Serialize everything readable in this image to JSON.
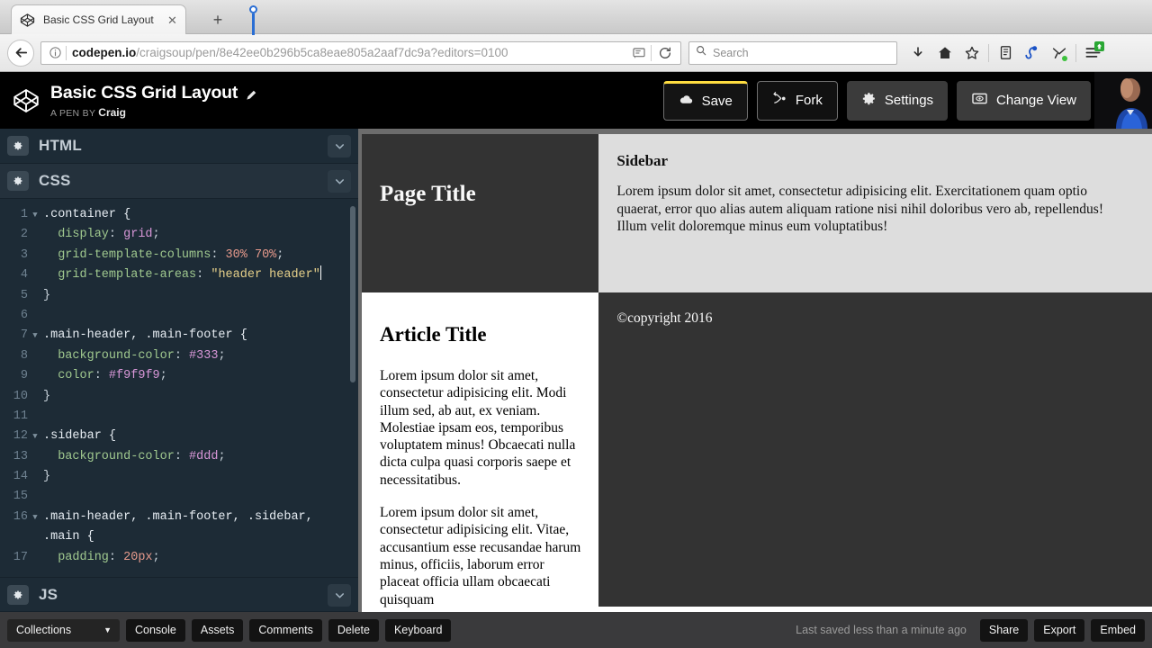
{
  "browser": {
    "tab": {
      "title": "Basic CSS Grid Layout",
      "favicon_icon": "codepen-favicon-icon",
      "close_icon": "close-icon"
    },
    "new_tab_label": "+",
    "back_icon": "back-arrow-icon",
    "url": {
      "domain": "codepen.io",
      "path": "/craigsoup/pen/8e42ee0b296b5ca8eae805a2aaf7dc9a?editors=0100"
    },
    "url_info_icon": "info-circle-icon",
    "reader_icon": "reader-view-icon",
    "reload_icon": "reload-icon",
    "search": {
      "placeholder": "Search",
      "icon": "search-icon"
    },
    "toolbar_icons": [
      "downloads-icon",
      "home-icon",
      "bookmark-star-icon",
      "library-icon",
      "sync-icon",
      "pocket-icon",
      "hamburger-menu-icon"
    ]
  },
  "codepen": {
    "logo_icon": "codepen-logo-icon",
    "pen_title": "Basic CSS Grid Layout",
    "edit_title_icon": "pencil-icon",
    "byline_prefix": "A PEN BY",
    "author": "Craig",
    "actions": [
      {
        "label": "Save",
        "icon": "cloud-icon",
        "style": "save"
      },
      {
        "label": "Fork",
        "icon": "fork-icon",
        "style": "outline"
      },
      {
        "label": "Settings",
        "icon": "gear-icon",
        "style": "solid"
      },
      {
        "label": "Change View",
        "icon": "screen-icon",
        "style": "solid"
      }
    ],
    "avatar_alt": "Craig",
    "editors": [
      {
        "name": "HTML",
        "collapsed": true,
        "gear_icon": "gear-icon",
        "chevron_icon": "chevron-down-icon"
      },
      {
        "name": "CSS",
        "collapsed": false,
        "gear_icon": "gear-icon",
        "chevron_icon": "chevron-down-icon"
      },
      {
        "name": "JS",
        "collapsed": true,
        "gear_icon": "gear-icon",
        "chevron_icon": "chevron-down-icon"
      }
    ],
    "css_code": [
      {
        "n": "1",
        "fold": true,
        "parts": [
          [
            "sel",
            ".container {"
          ]
        ]
      },
      {
        "n": "2",
        "fold": false,
        "parts": [
          [
            "plain",
            "  "
          ],
          [
            "prop",
            "display"
          ],
          [
            "punc",
            ": "
          ],
          [
            "val",
            "grid"
          ],
          [
            "punc",
            ";"
          ]
        ]
      },
      {
        "n": "3",
        "fold": false,
        "parts": [
          [
            "plain",
            "  "
          ],
          [
            "prop",
            "grid-template-columns"
          ],
          [
            "punc",
            ": "
          ],
          [
            "num",
            "30%"
          ],
          [
            "plain",
            " "
          ],
          [
            "num",
            "70%"
          ],
          [
            "punc",
            ";"
          ]
        ]
      },
      {
        "n": "4",
        "fold": false,
        "parts": [
          [
            "plain",
            "  "
          ],
          [
            "prop",
            "grid-template-areas"
          ],
          [
            "punc",
            ": "
          ],
          [
            "str",
            "\"header header\""
          ],
          [
            "caret",
            ""
          ]
        ]
      },
      {
        "n": "5",
        "fold": false,
        "parts": [
          [
            "punc",
            "}"
          ]
        ]
      },
      {
        "n": "6",
        "fold": false,
        "parts": []
      },
      {
        "n": "7",
        "fold": true,
        "parts": [
          [
            "sel",
            ".main-header, .main-footer {"
          ]
        ]
      },
      {
        "n": "8",
        "fold": false,
        "parts": [
          [
            "plain",
            "  "
          ],
          [
            "prop",
            "background-color"
          ],
          [
            "punc",
            ": "
          ],
          [
            "val",
            "#333"
          ],
          [
            "punc",
            ";"
          ]
        ]
      },
      {
        "n": "9",
        "fold": false,
        "parts": [
          [
            "plain",
            "  "
          ],
          [
            "prop",
            "color"
          ],
          [
            "punc",
            ": "
          ],
          [
            "val",
            "#f9f9f9"
          ],
          [
            "punc",
            ";"
          ]
        ]
      },
      {
        "n": "10",
        "fold": false,
        "parts": [
          [
            "punc",
            "}"
          ]
        ]
      },
      {
        "n": "11",
        "fold": false,
        "parts": []
      },
      {
        "n": "12",
        "fold": true,
        "parts": [
          [
            "sel",
            ".sidebar {"
          ]
        ]
      },
      {
        "n": "13",
        "fold": false,
        "parts": [
          [
            "plain",
            "  "
          ],
          [
            "prop",
            "background-color"
          ],
          [
            "punc",
            ": "
          ],
          [
            "val",
            "#ddd"
          ],
          [
            "punc",
            ";"
          ]
        ]
      },
      {
        "n": "14",
        "fold": false,
        "parts": [
          [
            "punc",
            "}"
          ]
        ]
      },
      {
        "n": "15",
        "fold": false,
        "parts": []
      },
      {
        "n": "16",
        "fold": true,
        "parts": [
          [
            "sel",
            ".main-header, .main-footer, .sidebar,"
          ]
        ]
      },
      {
        "n": "",
        "fold": false,
        "parts": [
          [
            "sel",
            ".main {"
          ]
        ]
      },
      {
        "n": "17",
        "fold": false,
        "parts": [
          [
            "plain",
            "  "
          ],
          [
            "prop",
            "padding"
          ],
          [
            "punc",
            ": "
          ],
          [
            "num",
            "20px"
          ],
          [
            "punc",
            ";"
          ]
        ]
      }
    ],
    "footer": {
      "collections_label": "Collections",
      "collections_caret_icon": "chevron-down-icon",
      "buttons": [
        "Console",
        "Assets",
        "Comments",
        "Delete",
        "Keyboard"
      ],
      "status": "Last saved less than a minute ago",
      "right_buttons": [
        "Share",
        "Export",
        "Embed"
      ]
    }
  },
  "preview": {
    "header_title": "Page Title",
    "sidebar_title": "Sidebar",
    "sidebar_text": "Lorem ipsum dolor sit amet, consectetur adipisicing elit. Exercitationem quam optio quaerat, error quo alias autem aliquam ratione nisi nihil doloribus vero ab, repellendus! Illum velit doloremque minus eum voluptatibus!",
    "article_title": "Article Title",
    "article_p1": "Lorem ipsum dolor sit amet, consectetur adipisicing elit. Modi illum sed, ab aut, ex veniam. Molestiae ipsam eos, temporibus voluptatem minus! Obcaecati nulla dicta culpa quasi corporis saepe et necessitatibus.",
    "article_p2": "Lorem ipsum dolor sit amet, consectetur adipisicing elit. Vitae, accusantium esse recusandae harum minus, officiis, laborum error placeat officia ullam obcaecati quisquam",
    "footer_text": "©copyright 2016"
  },
  "colors": {
    "accent_yellow": "#ffdd40",
    "editor_bg": "#1d2b36",
    "header_bg": "#000000",
    "preview_header_bg": "#333333",
    "preview_sidebar_bg": "#dddddd"
  }
}
